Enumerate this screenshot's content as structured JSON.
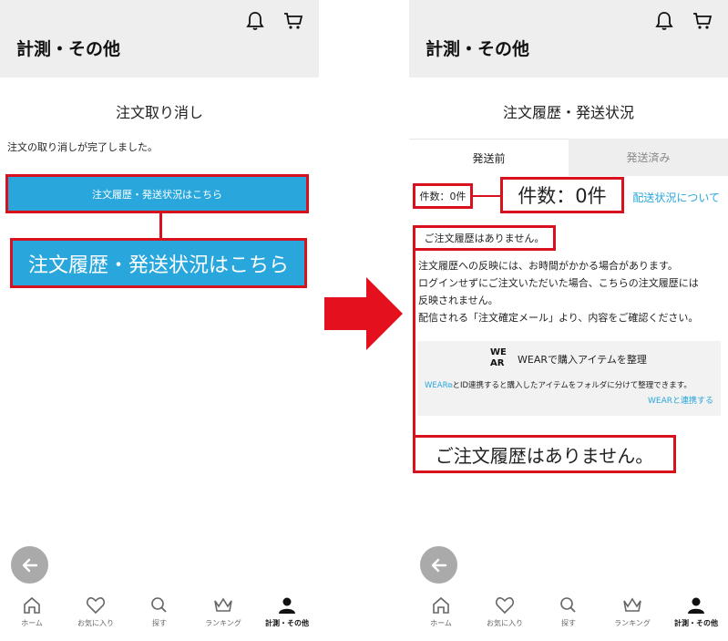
{
  "left_screen": {
    "header_title": "計測・その他",
    "page_title": "注文取り消し",
    "message": "注文の取り消しが完了しました。",
    "history_button_label": "注文履歴・発送状況はこちら",
    "callout_text": "注文履歴・発送状況はこちら"
  },
  "right_screen": {
    "header_title": "計測・その他",
    "page_title": "注文履歴・発送状況",
    "tabs": [
      {
        "label": "発送前",
        "active": true
      },
      {
        "label": "発送済み",
        "active": false
      }
    ],
    "count_label": "件数：0件",
    "count_callout": "件数：0件",
    "shipping_status_link": "配送状況について",
    "empty_message": "ご注文履歴はありません。",
    "note_lines": [
      "注文履歴への反映には、お時間がかかる場合があります。",
      "ログインせずにご注文いただいた場合、こちらの注文履歴には",
      "反映されません。",
      "配信される「注文確定メール」より、内容をご確認ください。"
    ],
    "wear": {
      "logo_line1": "WE",
      "logo_line2": "AR",
      "title": "WEARで購入アイテムを整理",
      "desc_link": "WEAR",
      "desc_rest": "とID連携すると購入したアイテムをフォルダに分けて整理できます。",
      "connect_link": "WEARと連携する"
    },
    "empty_callout": "ご注文履歴はありません。"
  },
  "bottom_nav": [
    {
      "label": "ホーム",
      "icon": "home-icon",
      "active": false
    },
    {
      "label": "お気に入り",
      "icon": "heart-icon",
      "active": false
    },
    {
      "label": "探す",
      "icon": "search-icon",
      "active": false
    },
    {
      "label": "ランキング",
      "icon": "crown-icon",
      "active": false
    },
    {
      "label": "計測・その他",
      "icon": "person-icon",
      "active": true
    }
  ],
  "colors": {
    "accent_blue": "#29a7dd",
    "highlight_red": "#d8111e",
    "header_gray": "#eeeeee"
  }
}
